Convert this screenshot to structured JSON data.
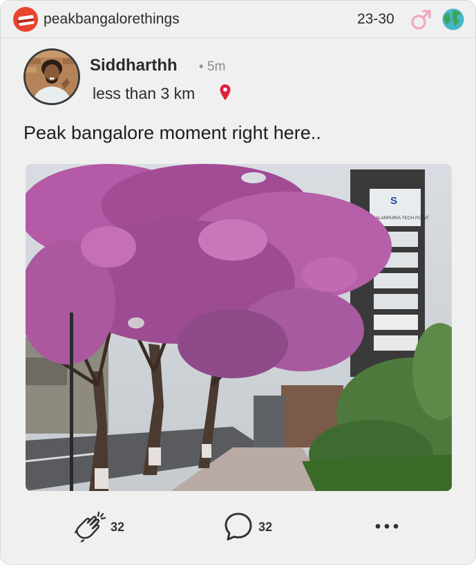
{
  "group": {
    "name": "peakbangalorethings",
    "age_range": "23-30",
    "logo_icon": "newspaper-logo-icon",
    "gender_icon": "male-symbol-icon",
    "region_icon": "globe-icon"
  },
  "post": {
    "author": "Siddharthh",
    "separator": "•",
    "time_ago": "5m",
    "distance": "less than 3 km",
    "text": "Peak bangalore moment right here..",
    "photo_sign_lines": [
      "S",
      "SALARPURIA TECH POINT"
    ]
  },
  "actions": {
    "claps": "32",
    "comments": "32",
    "clap_icon": "clap-icon",
    "comment_icon": "comment-bubble-icon",
    "more_icon": "more-dots-icon"
  },
  "colors": {
    "pin": "#e0213a",
    "gender": "#f2a6bd",
    "globe_land": "#3aa65a",
    "globe_sea": "#47b6c9",
    "logo": "#e9442e",
    "blossom": "#b45aa6"
  }
}
